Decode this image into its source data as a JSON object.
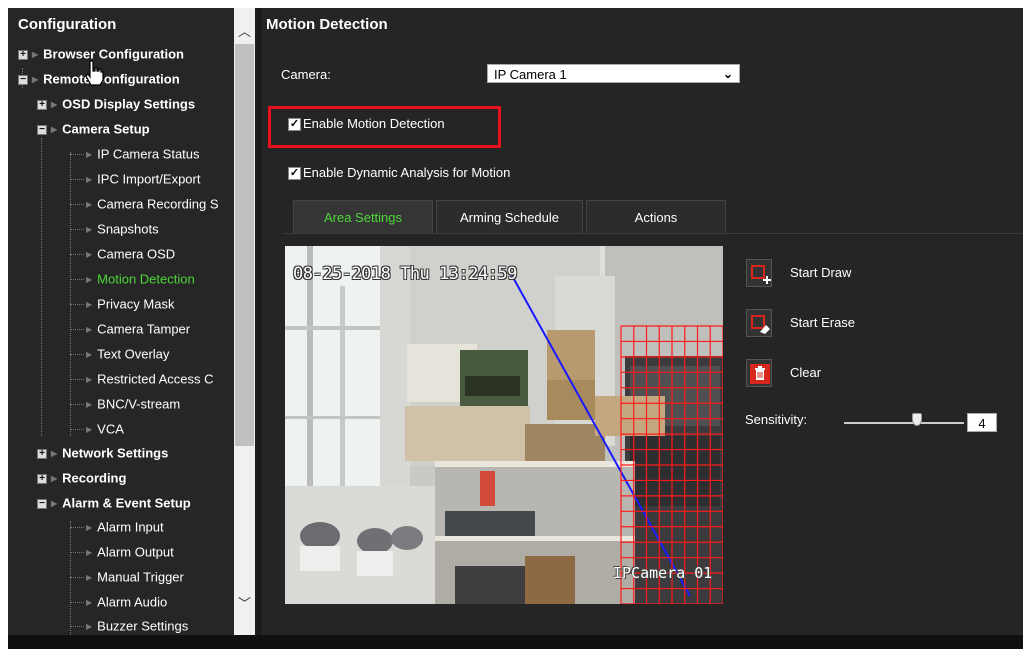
{
  "sidebar": {
    "title": "Configuration",
    "items": [
      {
        "label": "Browser Configuration",
        "expander": "+",
        "bold": true
      },
      {
        "label": "Remote Configuration",
        "expander": "−",
        "bold": true
      },
      {
        "label": "OSD Display Settings",
        "expander": "+",
        "bold": true
      },
      {
        "label": "Camera Setup",
        "expander": "−",
        "bold": true
      },
      {
        "label": "IP Camera Status"
      },
      {
        "label": "IPC Import/Export"
      },
      {
        "label": "Camera Recording S"
      },
      {
        "label": "Snapshots"
      },
      {
        "label": "Camera OSD"
      },
      {
        "label": "Motion Detection",
        "selected": true
      },
      {
        "label": "Privacy Mask"
      },
      {
        "label": "Camera Tamper"
      },
      {
        "label": "Text Overlay"
      },
      {
        "label": "Restricted Access C"
      },
      {
        "label": "BNC/V-stream"
      },
      {
        "label": "VCA"
      },
      {
        "label": "Network Settings",
        "expander": "+",
        "bold": true
      },
      {
        "label": "Recording",
        "expander": "+",
        "bold": true
      },
      {
        "label": "Alarm & Event Setup",
        "expander": "−",
        "bold": true
      },
      {
        "label": "Alarm Input"
      },
      {
        "label": "Alarm Output"
      },
      {
        "label": "Manual Trigger"
      },
      {
        "label": "Alarm Audio"
      },
      {
        "label": "Buzzer Settings"
      }
    ]
  },
  "main": {
    "title": "Motion Detection",
    "camera_label": "Camera:",
    "camera_value": "IP Camera 1",
    "enable_motion_label": "Enable Motion Detection",
    "enable_dynamic_label": "Enable Dynamic Analysis for Motion",
    "tabs": [
      {
        "label": "Area Settings",
        "active": true
      },
      {
        "label": "Arming Schedule"
      },
      {
        "label": "Actions"
      }
    ],
    "osd_timestamp": "08-25-2018 Thu 13:24:59",
    "osd_camera_name": "IPCamera 01",
    "tools": {
      "start_draw": "Start Draw",
      "start_erase": "Start Erase",
      "clear": "Clear"
    },
    "sensitivity_label": "Sensitivity:",
    "sensitivity_value": "4"
  },
  "colors": {
    "accent_green": "#4ed63a",
    "highlight_red": "#e8121e",
    "grid_red": "#ff1a1a",
    "line_blue": "#1a1aff",
    "tool_red": "#d6261e"
  }
}
